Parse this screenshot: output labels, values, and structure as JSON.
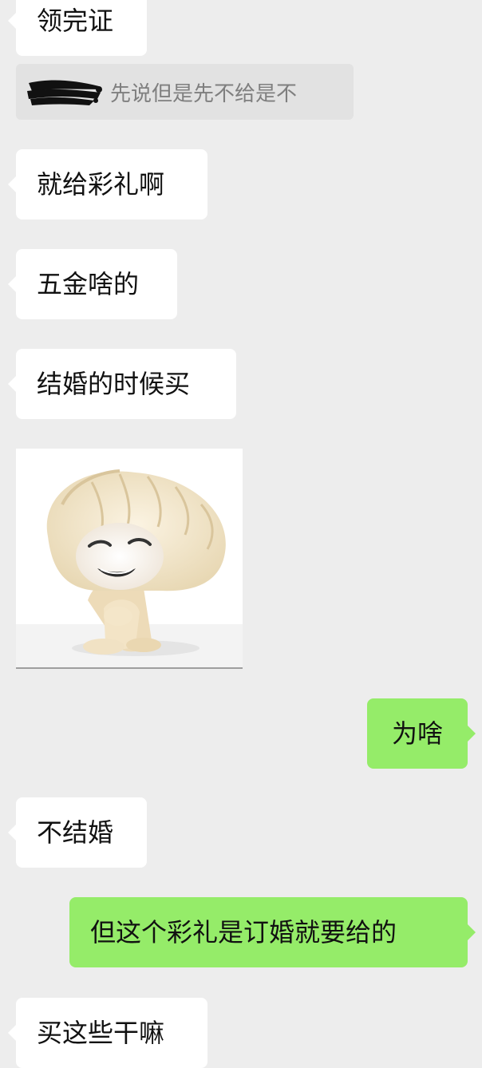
{
  "messages": [
    {
      "text": "领完证"
    },
    {
      "text": "就给彩礼啊"
    },
    {
      "text": "五金啥的"
    },
    {
      "text": "结婚的时候买"
    },
    {
      "text": "为啥"
    },
    {
      "text": "不结婚"
    },
    {
      "text": "但这个彩礼是订婚就要给的"
    },
    {
      "text": "买这些干嘛"
    }
  ],
  "quote": {
    "text": "先说但是先不给是不"
  },
  "sticker": {
    "subject": "dumpling-character-sticker"
  },
  "colors": {
    "background": "#ededed",
    "incoming_bubble": "#ffffff",
    "outgoing_bubble": "#95ec69",
    "quote_background": "#e2e2e2"
  }
}
